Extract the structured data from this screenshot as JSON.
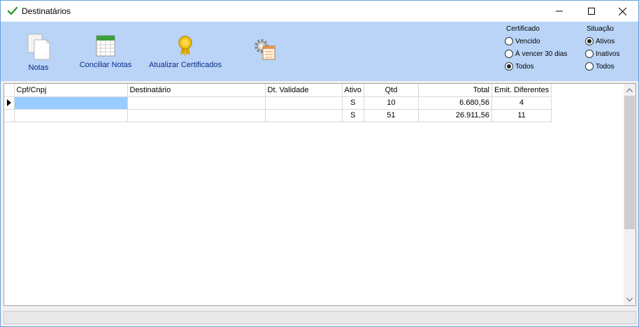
{
  "window": {
    "title": "Destinatários"
  },
  "toolbar": {
    "notas_label": "Notas",
    "conciliar_label": "Conciliar Notas",
    "atualizar_label": "Atualizar Certificados"
  },
  "certificado": {
    "title": "Certificado",
    "options": [
      "Vencido",
      "À  vencer 30 dias",
      "Todos"
    ],
    "selected": "Todos"
  },
  "situacao": {
    "title": "Situação",
    "options": [
      "Ativos",
      "Inativos",
      "Todos"
    ],
    "selected": "Ativos"
  },
  "grid": {
    "columns": [
      "Cpf/Cnpj",
      "Destinatário",
      "Dt. Validade",
      "Ativo",
      "Qtd",
      "Total",
      "Emit. Diferentes"
    ],
    "rows": [
      {
        "cpf": "",
        "destinatario": "",
        "validade": "",
        "ativo": "S",
        "qtd": "10",
        "total": "6.680,56",
        "emit": "4"
      },
      {
        "cpf": "",
        "destinatario": "",
        "validade": "",
        "ativo": "S",
        "qtd": "51",
        "total": "26.911,56",
        "emit": "11"
      }
    ]
  }
}
